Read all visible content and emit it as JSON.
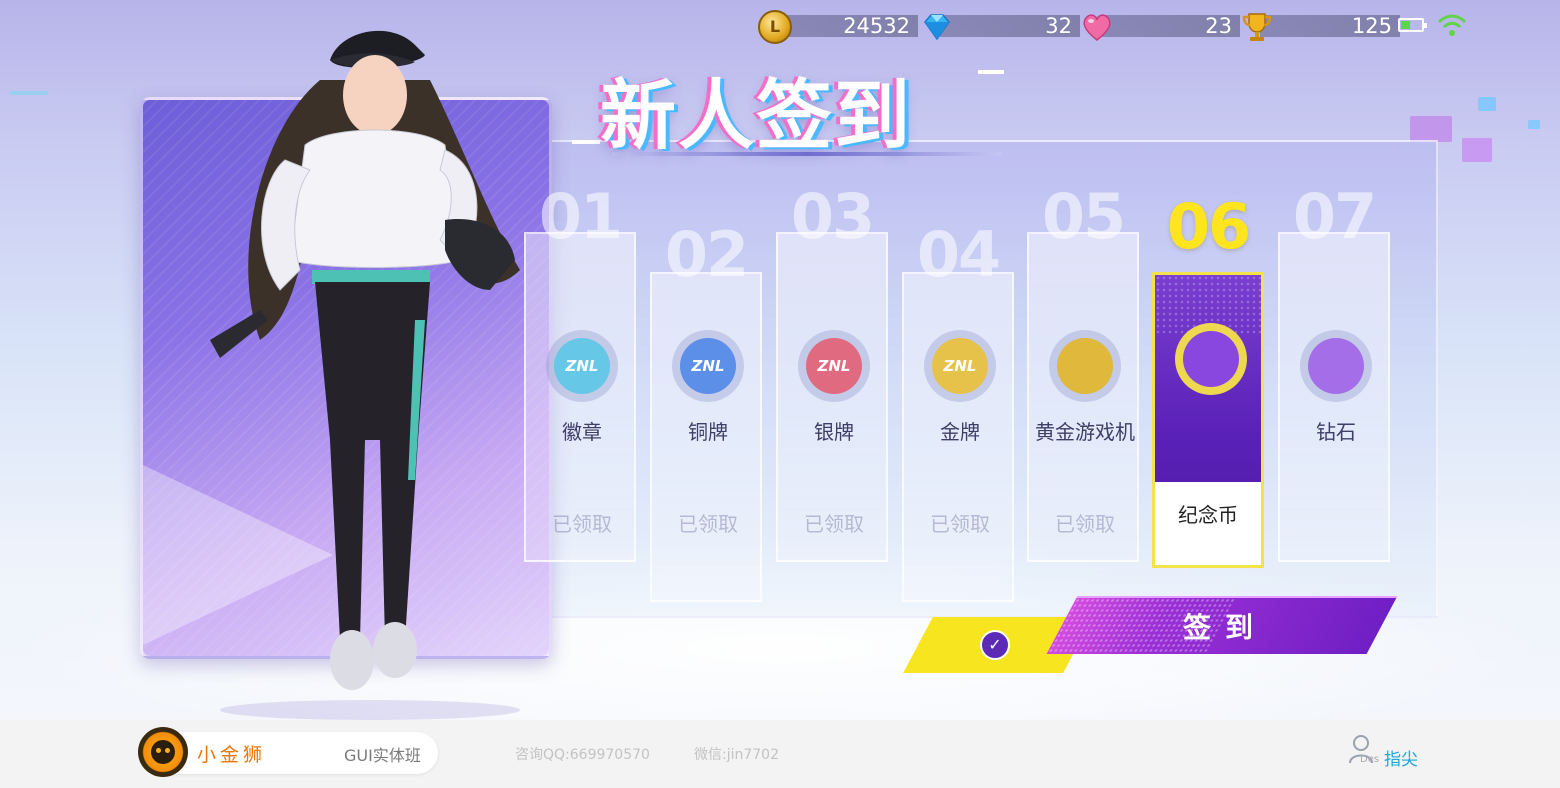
{
  "currencies": {
    "coins": {
      "icon": "coin-icon",
      "value": "24532"
    },
    "diamonds": {
      "icon": "diamond-icon",
      "value": "32"
    },
    "hearts": {
      "icon": "heart-icon",
      "value": "23"
    },
    "trophies": {
      "icon": "trophy-icon",
      "value": "125"
    }
  },
  "status": {
    "battery_icon": "battery-icon",
    "wifi_icon": "wifi-icon",
    "battery_color": "#5bd54b"
  },
  "title": "新人签到",
  "days": [
    {
      "num": "01",
      "label": "徽章",
      "status": "已领取",
      "icon": "badge-icon",
      "icon_text": "ZNL"
    },
    {
      "num": "02",
      "label": "铜牌",
      "status": "已领取",
      "icon": "bronze-medal-icon",
      "icon_text": "ZNL"
    },
    {
      "num": "03",
      "label": "银牌",
      "status": "已领取",
      "icon": "silver-medal-icon",
      "icon_text": "ZNL"
    },
    {
      "num": "04",
      "label": "金牌",
      "status": "已领取",
      "icon": "gold-medal-icon",
      "icon_text": "ZNL"
    },
    {
      "num": "05",
      "label": "黄金游戏机",
      "status": "已领取",
      "icon": "gamepad-icon",
      "icon_text": ""
    },
    {
      "num": "06",
      "label": "纪念币",
      "status": "",
      "icon": "commemorative-coin-icon",
      "icon_text": "",
      "active": true
    },
    {
      "num": "07",
      "label": "钻石",
      "status": "",
      "icon": "diamond-rank-icon",
      "icon_text": ""
    }
  ],
  "actions": {
    "check_icon": "check-icon",
    "sign_label": "签到"
  },
  "footer": {
    "brand_logo": "lion-logo",
    "brand_name": "小金狮",
    "course": "GUI实体班",
    "qq": "咨询QQ:669970570",
    "wechat": "微信:jin7702",
    "author_icon": "user-icon",
    "author_des": "Des",
    "author_name": "指尖"
  },
  "colors": {
    "accent_purple": "#5a21b8",
    "accent_yellow": "#f6e51f",
    "brand_orange": "#e8770c",
    "author_blue": "#18a8e0"
  }
}
